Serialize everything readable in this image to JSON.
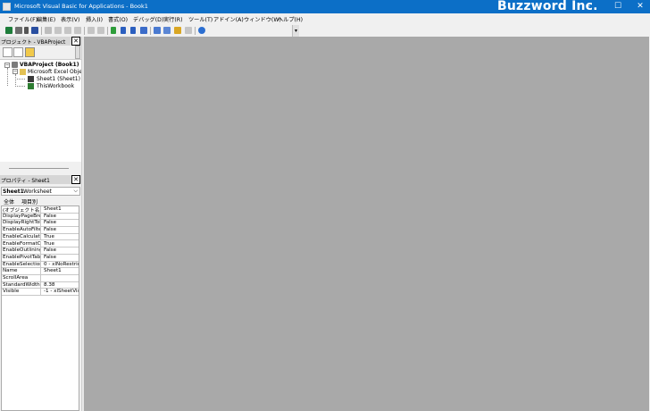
{
  "window": {
    "title": "Microsoft Visual Basic for Applications - Book1",
    "watermark": "Buzzword Inc.",
    "minimize": "–",
    "maximize": "☐",
    "close": "✕"
  },
  "menu": {
    "items": [
      "ファイル(F)",
      "編集(E)",
      "表示(V)",
      "挿入(I)",
      "書式(O)",
      "デバッグ(D)",
      "実行(R)",
      "ツール(T)",
      "アドイン(A)",
      "ウィンドウ(W)",
      "ヘルプ(H)"
    ]
  },
  "toolbar": {
    "overflow_glyph": "▾"
  },
  "project_pane": {
    "title": "プロジェクト - VBAProject",
    "close": "✕",
    "tree": {
      "root": "VBAProject (Book1)",
      "folder": "Microsoft Excel Objec",
      "items": [
        "Sheet1 (Sheet1)",
        "ThisWorkbook"
      ]
    }
  },
  "properties_pane": {
    "title": "プロパティ - Sheet1",
    "close": "✕",
    "object_name": "Sheet1",
    "object_type": "Worksheet",
    "dropdown_glyph": "⌵",
    "tabs": [
      "全体",
      "項目別"
    ],
    "rows": [
      {
        "name": "(オブジェクト名)",
        "value": "Sheet1"
      },
      {
        "name": "DisplayPageBrea",
        "value": "False"
      },
      {
        "name": "DisplayRightToLe",
        "value": "False"
      },
      {
        "name": "EnableAutoFilter",
        "value": "False"
      },
      {
        "name": "EnableCalculatio",
        "value": "True"
      },
      {
        "name": "EnableFormatCon",
        "value": "True"
      },
      {
        "name": "EnableOutlining",
        "value": "False"
      },
      {
        "name": "EnablePivotTable",
        "value": "False"
      },
      {
        "name": "EnableSelection",
        "value": "0 - xlNoRestric"
      },
      {
        "name": "Name",
        "value": "Sheet1"
      },
      {
        "name": "ScrollArea",
        "value": ""
      },
      {
        "name": "StandardWidth",
        "value": "8.38"
      },
      {
        "name": "Visible",
        "value": "-1 - xlSheetVis"
      }
    ]
  },
  "colors": {
    "titlebar": "#0c6fc7",
    "workspace": "#a9a9a9",
    "panel": "#f0f0f0"
  }
}
